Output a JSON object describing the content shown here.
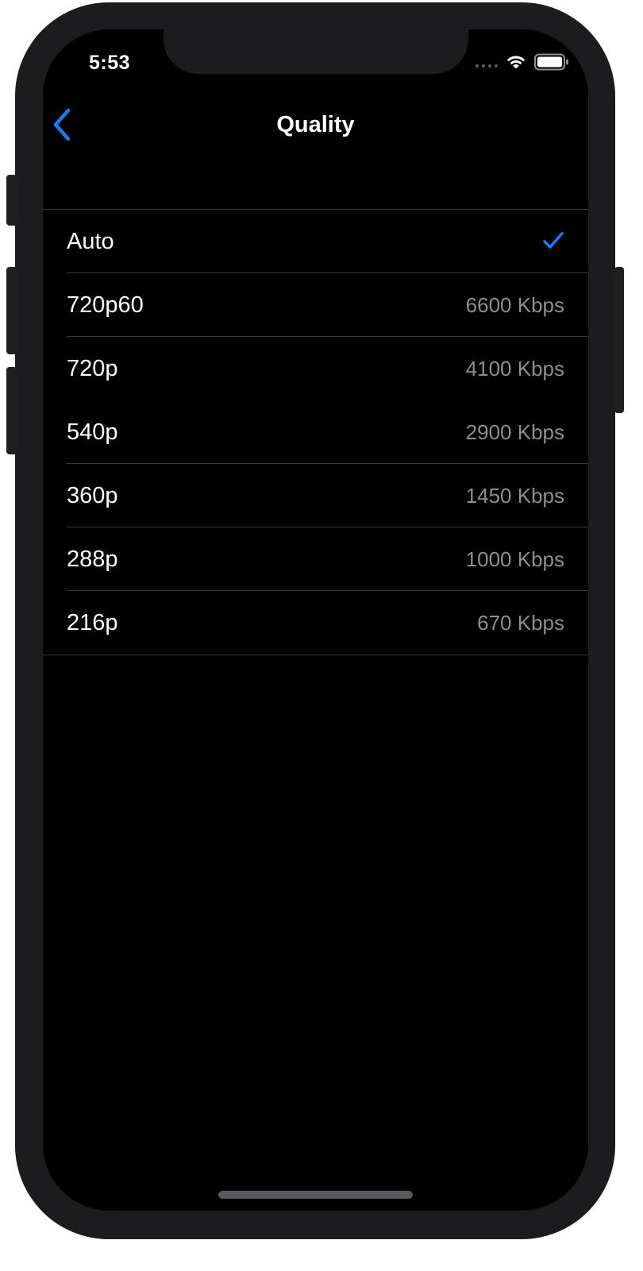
{
  "status_bar": {
    "time": "5:53"
  },
  "nav": {
    "title": "Quality",
    "back_icon": "chevron-left-icon"
  },
  "colors": {
    "accent": "#1a7cf5",
    "background": "#000000",
    "secondary_text": "#8e8e93"
  },
  "quality_options": [
    {
      "label": "Auto",
      "detail": "",
      "selected": true
    },
    {
      "label": "720p60",
      "detail": "6600 Kbps",
      "selected": false
    },
    {
      "label": "720p",
      "detail": "4100 Kbps",
      "selected": false
    },
    {
      "label": "540p",
      "detail": "2900 Kbps",
      "selected": false
    },
    {
      "label": "360p",
      "detail": "1450 Kbps",
      "selected": false
    },
    {
      "label": "288p",
      "detail": "1000 Kbps",
      "selected": false
    },
    {
      "label": "216p",
      "detail": "670 Kbps",
      "selected": false
    }
  ]
}
